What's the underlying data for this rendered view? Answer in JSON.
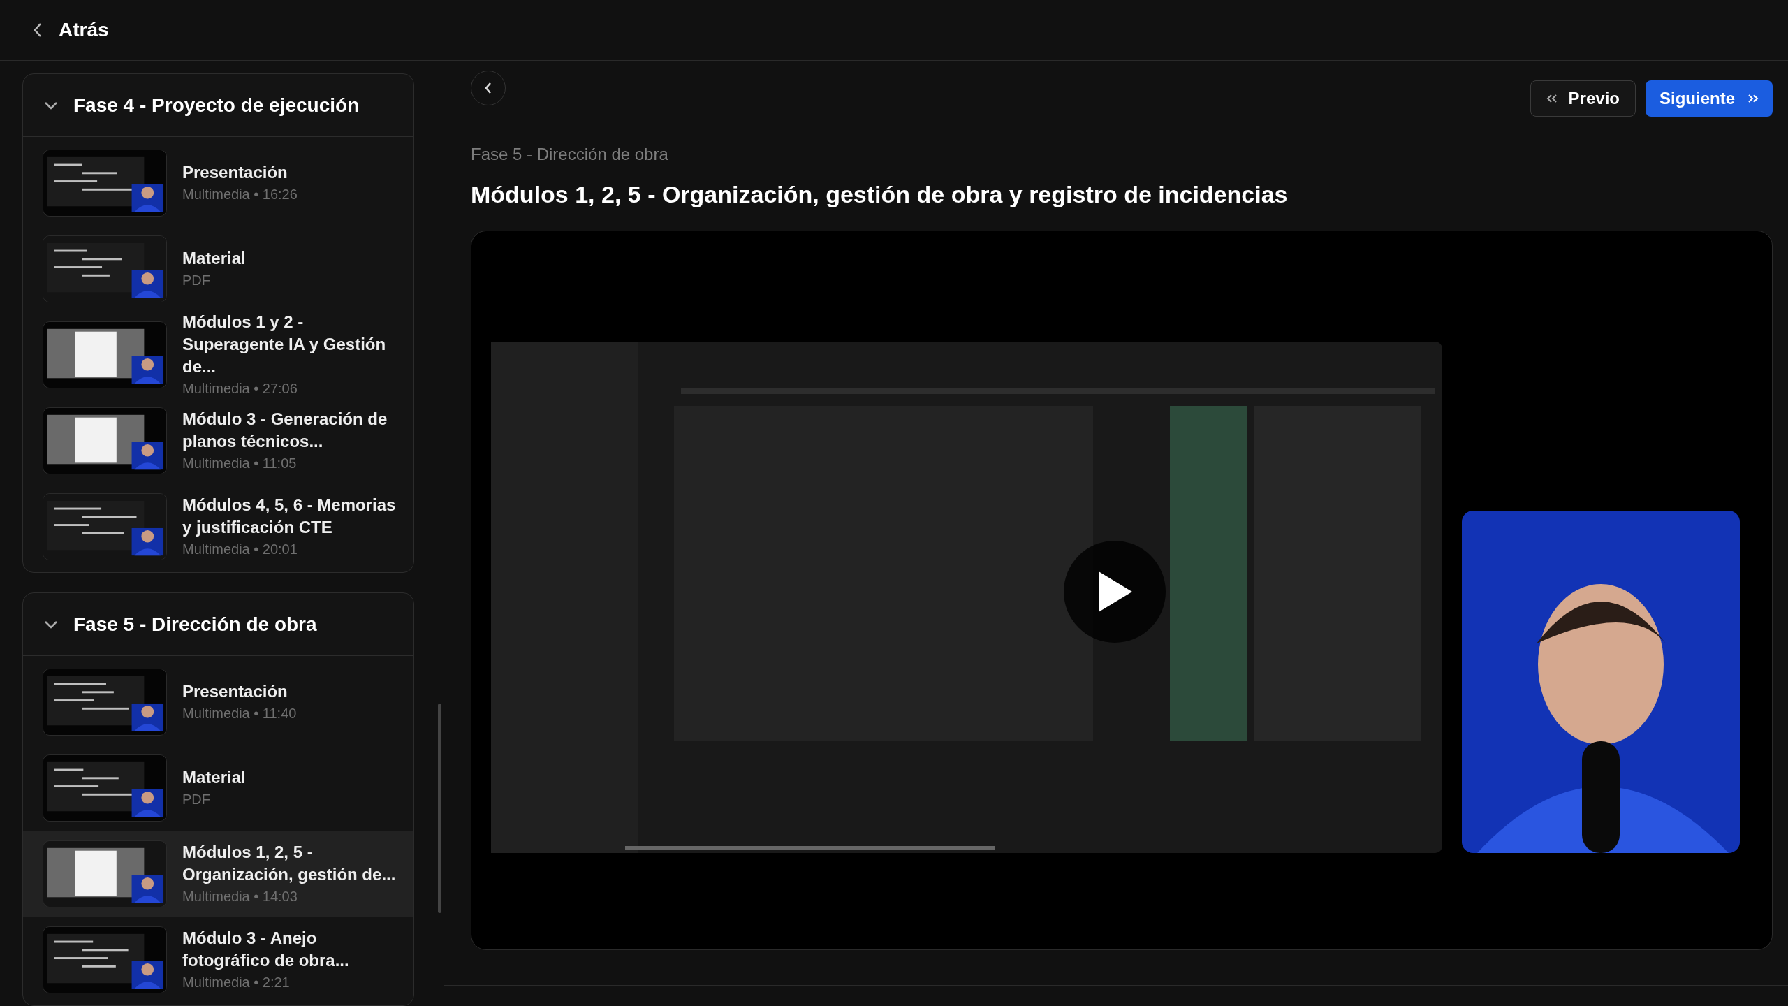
{
  "header": {
    "back_label": "Atrás"
  },
  "sections": [
    {
      "title": "Fase 4 - Proyecto de ejecución",
      "expanded": true,
      "items": [
        {
          "title": "Presentación",
          "meta": "Multimedia • 16:26",
          "selected": false
        },
        {
          "title": "Material",
          "meta": "PDF",
          "selected": false
        },
        {
          "title": "Módulos 1 y 2 - Superagente IA y Gestión de...",
          "meta": "Multimedia • 27:06",
          "selected": false
        },
        {
          "title": "Módulo 3 - Generación de planos técnicos...",
          "meta": "Multimedia • 11:05",
          "selected": false
        },
        {
          "title": "Módulos 4, 5, 6 - Memorias y justificación CTE",
          "meta": "Multimedia • 20:01",
          "selected": false
        }
      ]
    },
    {
      "title": "Fase 5 - Dirección de obra",
      "expanded": true,
      "items": [
        {
          "title": "Presentación",
          "meta": "Multimedia • 11:40",
          "selected": false
        },
        {
          "title": "Material",
          "meta": "PDF",
          "selected": false
        },
        {
          "title": "Módulos 1, 2, 5 - Organización, gestión de...",
          "meta": "Multimedia • 14:03",
          "selected": true
        },
        {
          "title": "Módulo 3 - Anejo fotográfico de obra...",
          "meta": "Multimedia • 2:21",
          "selected": false
        }
      ]
    }
  ],
  "lesson": {
    "breadcrumb": "Fase 5 - Dirección de obra",
    "title": "Módulos 1, 2, 5 - Organización, gestión de obra y registro de incidencias",
    "previous_label": "Previo",
    "next_label": "Siguiente"
  }
}
